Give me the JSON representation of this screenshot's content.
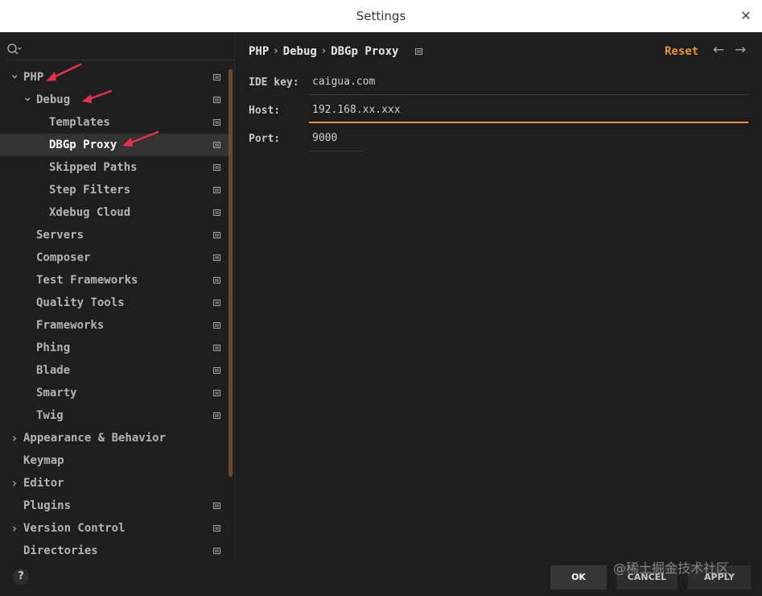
{
  "window": {
    "title": "Settings",
    "close_symbol": "✕"
  },
  "sidebar": {
    "search": {
      "value": "",
      "placeholder": ""
    },
    "items": [
      {
        "label": "PHP",
        "indent": 0,
        "chevron": "expanded",
        "page_icon": true
      },
      {
        "label": "Debug",
        "indent": 1,
        "chevron": "expanded",
        "page_icon": true
      },
      {
        "label": "Templates",
        "indent": 2,
        "chevron": "none",
        "page_icon": true
      },
      {
        "label": "DBGp Proxy",
        "indent": 2,
        "chevron": "none",
        "page_icon": true,
        "selected": true
      },
      {
        "label": "Skipped Paths",
        "indent": 2,
        "chevron": "none",
        "page_icon": true
      },
      {
        "label": "Step Filters",
        "indent": 2,
        "chevron": "none",
        "page_icon": true
      },
      {
        "label": "Xdebug Cloud",
        "indent": 2,
        "chevron": "none",
        "page_icon": true
      },
      {
        "label": "Servers",
        "indent": 1,
        "chevron": "none",
        "page_icon": true
      },
      {
        "label": "Composer",
        "indent": 1,
        "chevron": "none",
        "page_icon": true
      },
      {
        "label": "Test Frameworks",
        "indent": 1,
        "chevron": "none",
        "page_icon": true
      },
      {
        "label": "Quality Tools",
        "indent": 1,
        "chevron": "none",
        "page_icon": true
      },
      {
        "label": "Frameworks",
        "indent": 1,
        "chevron": "none",
        "page_icon": true
      },
      {
        "label": "Phing",
        "indent": 1,
        "chevron": "none",
        "page_icon": true
      },
      {
        "label": "Blade",
        "indent": 1,
        "chevron": "none",
        "page_icon": true
      },
      {
        "label": "Smarty",
        "indent": 1,
        "chevron": "none",
        "page_icon": true
      },
      {
        "label": "Twig",
        "indent": 1,
        "chevron": "none",
        "page_icon": true
      },
      {
        "label": "Appearance & Behavior",
        "indent": 0,
        "chevron": "collapsed",
        "page_icon": false
      },
      {
        "label": "Keymap",
        "indent": 0,
        "chevron": "none",
        "page_icon": false
      },
      {
        "label": "Editor",
        "indent": 0,
        "chevron": "collapsed",
        "page_icon": false
      },
      {
        "label": "Plugins",
        "indent": 0,
        "chevron": "none",
        "page_icon": true
      },
      {
        "label": "Version Control",
        "indent": 0,
        "chevron": "collapsed",
        "page_icon": true
      },
      {
        "label": "Directories",
        "indent": 0,
        "chevron": "none",
        "page_icon": true
      }
    ]
  },
  "content": {
    "breadcrumb": [
      "PHP",
      "Debug",
      "DBGp Proxy"
    ],
    "breadcrumb_separator": "›",
    "reset_label": "Reset",
    "back_symbol": "←",
    "forward_symbol": "→",
    "fields": {
      "ide_key": {
        "label": "IDE key:",
        "value": "caigua.com"
      },
      "host": {
        "label": "Host:",
        "value": "192.168.xx.xxx"
      },
      "port": {
        "label": "Port:",
        "value": "9000"
      }
    }
  },
  "footer": {
    "help_label": "?",
    "ok_label": "OK",
    "cancel_label": "CANCEL",
    "apply_label": "APPLY",
    "watermark": "@稀土掘金技术社区"
  },
  "colors": {
    "accent": "#e8912d",
    "annotation_arrow": "#e8304a",
    "background": "#1e1e1e",
    "selected_row": "#333333"
  },
  "icons": {
    "search": "search-icon",
    "page": "page-icon",
    "chevron_expanded": "chevron-down-icon",
    "chevron_collapsed": "chevron-right-icon",
    "annotation": "red-arrow-icon"
  }
}
